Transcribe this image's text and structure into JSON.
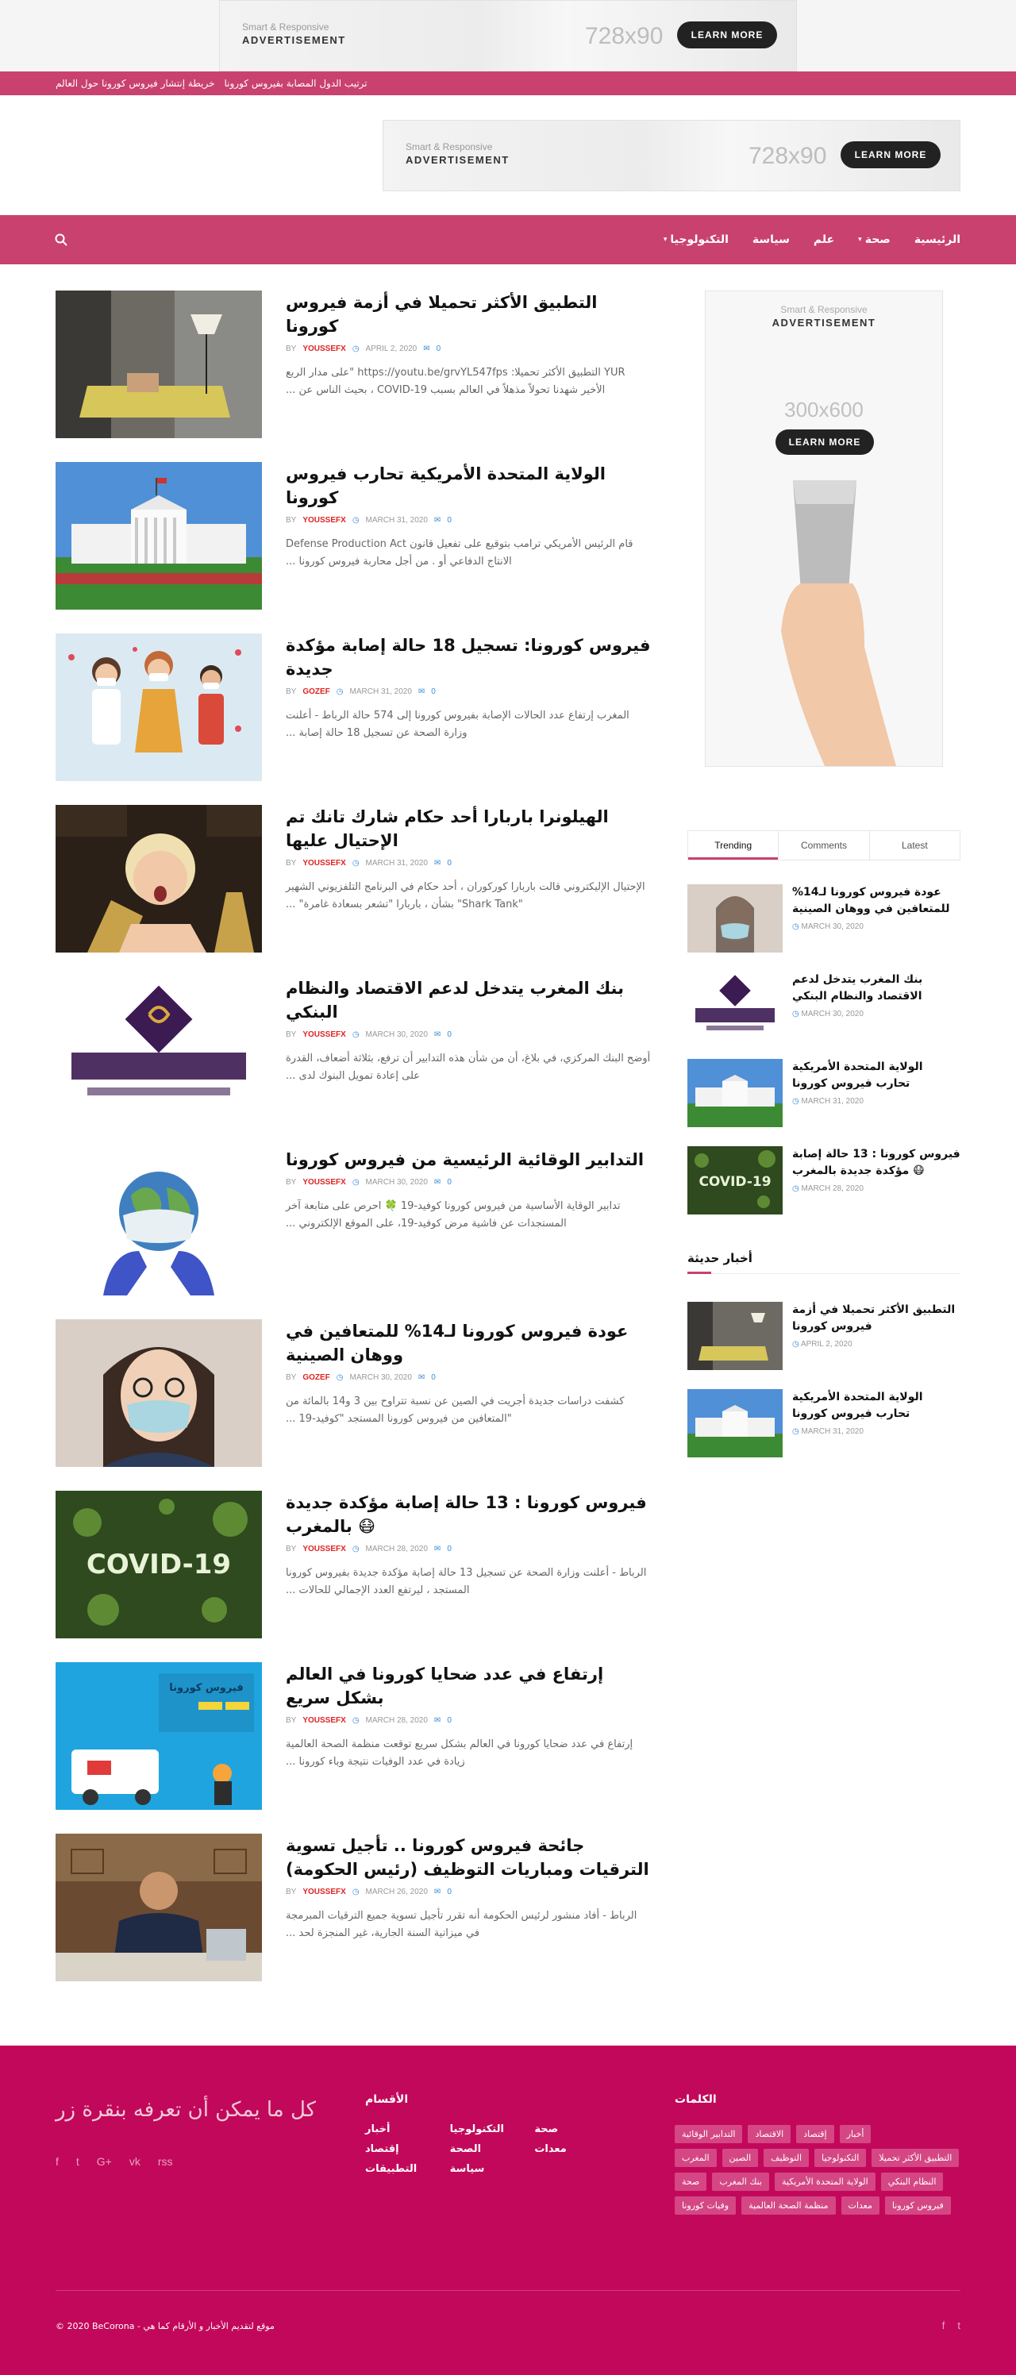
{
  "ads": {
    "top_small": "Smart & Responsive",
    "top_big": "ADVERTISEMENT",
    "top_size": "728x90",
    "top_button": "LEARN MORE",
    "header_small": "Smart & Responsive",
    "header_big": "ADVERTISEMENT",
    "header_size": "728x90",
    "header_button": "LEARN MORE",
    "side_small": "Smart & Responsive",
    "side_big": "ADVERTISEMENT",
    "side_size": "300x600",
    "side_button": "LEARN MORE"
  },
  "trending_links": [
    "ترتيب الدول المصابة بفيروس كورونا",
    "خريطة إنتشار فيروس كورونا حول العالم"
  ],
  "nav": {
    "items": [
      "الرئيسية",
      "صحة",
      "علم",
      "سياسة",
      "التكنولوجيا"
    ],
    "search_icon": "search-icon"
  },
  "articles": [
    {
      "title": "التطبيق الأكثر تحميلا في أزمة فيروس كورونا",
      "by": "BY",
      "author": "YOUSSEFX",
      "date": "APRIL 2, 2020",
      "comments": "0",
      "excerpt": "YUR التطبيق الأكثر تحميلا: https://youtu.be/grvYL547fps \"على مدار الربع الأخير شهدنا تحولاً مذهلاً في العالم بسبب COVID-19 ، بحيث الناس عن ..."
    },
    {
      "title": "الولاية المتحدة الأمريكية تحارب فيروس كورونا",
      "by": "BY",
      "author": "YOUSSEFX",
      "date": "MARCH 31, 2020",
      "comments": "0",
      "excerpt": "قام الرئيس الأمريكي ترامب بتوقيع على تفعيل قانون Defense Production Act الانتاج الدفاعي أو . من أجل محاربة فيروس كورونا ..."
    },
    {
      "title": "فيروس كورونا: تسجيل 18 حالة إصابة مؤكدة جديدة",
      "by": "BY",
      "author": "GOZEF",
      "date": "MARCH 31, 2020",
      "comments": "0",
      "excerpt": "المغرب إرتفاع عدد الحالات الإصابة بفيروس كورونا إلى 574 حالة الرباط - أعلنت وزارة الصحة عن تسجيل 18 حالة إصابة ..."
    },
    {
      "title": "الهيلونرا باربارا أحد حكام شارك تانك تم الإحتيال عليها",
      "by": "BY",
      "author": "YOUSSEFX",
      "date": "MARCH 31, 2020",
      "comments": "0",
      "excerpt": "الإحتيال الإليكتروني قالت باربارا كوركوران ، أحد حكام في البرنامج التلفزيوني الشهير \"Shark Tank\" بشأن ، باربارا \"تشعر بسعادة غامرة\" ..."
    },
    {
      "title": "بنك المغرب يتدخل لدعم الاقتصاد والنظام البنكي",
      "by": "BY",
      "author": "YOUSSEFX",
      "date": "MARCH 30, 2020",
      "comments": "0",
      "excerpt": "أوضح البنك المركزي، في بلاغ، أن من شأن هذه التدابير أن ترفع، بثلاثة أضعاف، القدرة على إعادة تمويل البنوك لدى ..."
    },
    {
      "title": "التدابير الوقائية الرئيسية من فيروس كورونا",
      "by": "BY",
      "author": "YOUSSEFX",
      "date": "MARCH 30, 2020",
      "comments": "0",
      "excerpt": "تدابير الوقاية الأساسية من فيروس كورونا كوفيد-19 🍀 احرص على متابعة آخر المستجدات عن فاشية مرض كوفيد-19، على الموقع الإلكتروني ..."
    },
    {
      "title": "عودة فيروس كورونا لـ14% للمتعافين في ووهان الصينية",
      "by": "BY",
      "author": "GOZEF",
      "date": "MARCH 30, 2020",
      "comments": "0",
      "excerpt": "كشفت دراسات جديدة أجريت في الصين عن نسبة تتراوح بين 3 و14 بالمائة من \"المتعافين من فيروس كورونا المستجد \"كوفيد-19 ..."
    },
    {
      "title": "فيروس كورونا : 13 حالة إصابة مؤكدة جديدة 😷 بالمغرب",
      "by": "BY",
      "author": "YOUSSEFX",
      "date": "MARCH 28, 2020",
      "comments": "0",
      "excerpt": "الرباط - أعلنت وزارة الصحة عن تسجيل 13 حالة إصابة مؤكدة جديدة بفيروس كورونا المستجد ، ليرتفع العدد الإجمالي للحالات ..."
    },
    {
      "title": "إرتفاع في عدد ضحايا كورونا في العالم بشكل سريع",
      "by": "BY",
      "author": "YOUSSEFX",
      "date": "MARCH 28, 2020",
      "comments": "0",
      "excerpt": "إرتفاع في عدد ضحايا كورونا في العالم بشكل سريع توقعت منظمة الصحة العالمية زيادة في عدد الوفيات نتيجة وباء كورونا ..."
    },
    {
      "title": "جائحة فيروس كورونا .. تأجيل تسوية الترقيات ومباريات التوظيف (رئيس الحكومة)",
      "by": "BY",
      "author": "YOUSSEFX",
      "date": "MARCH 26, 2020",
      "comments": "0",
      "excerpt": "الرباط - أفاد منشور لرئيس الحكومة أنه تقرر تأجيل تسوية جميع الترقيات المبرمجة في ميزانية السنة الجارية، غير المنجزة لحد ..."
    }
  ],
  "tabs": [
    "Trending",
    "Comments",
    "Latest"
  ],
  "trending": [
    {
      "title": "عودة فيروس كورونا لـ14% للمتعافين في ووهان الصينية",
      "date": "MARCH 30, 2020"
    },
    {
      "title": "بنك المغرب يتدخل لدعم الاقتصاد والنظام البنكي",
      "date": "MARCH 30, 2020"
    },
    {
      "title": "الولاية المتحدة الأمريكية تحارب فيروس كورونا",
      "date": "MARCH 31, 2020"
    },
    {
      "title": "فيروس كورونا : 13 حالة إصابة 😷 مؤكدة جديدة بالمغرب",
      "date": "MARCH 28, 2020"
    }
  ],
  "recent_heading": "أخبار حديثة",
  "recent": [
    {
      "title": "التطبيق الأكثر تحميلا في أزمة فيروس كورونا",
      "date": "APRIL 2, 2020"
    },
    {
      "title": "الولاية المتحدة الأمريكية تحارب فيروس كورونا",
      "date": "MARCH 31, 2020"
    }
  ],
  "footer": {
    "tagline": "كل ما يمكن أن تعرفه بنقرة زر",
    "sections_title": "الأقسام",
    "sections": [
      "صحة",
      "التكنولوجيا",
      "أخبار",
      "معدات",
      "الصحة",
      "إقتصاد",
      "",
      "سياسة",
      "التطبيقات"
    ],
    "tags_title": "الكلمات",
    "tags": [
      "أخبار",
      "إقتصاد",
      "الاقتصاد",
      "التدابير الوقائية",
      "التطبيق الأكثر تحميلا",
      "التكنولوجيا",
      "التوظيف",
      "الصين",
      "المغرب",
      "النظام البنكي",
      "الولاية المتحدة الأمريكية",
      "بنك المغرب",
      "صحة",
      "فيروس كورونا",
      "معدات",
      "منظمة الصحة العالمية",
      "وفيات كورونا"
    ],
    "copyright": "© 2020 BeCorona - موقع لتقديم الأخبار و الأرقام كما هي",
    "social": [
      "f",
      "t",
      "G+",
      "vk",
      "rss"
    ],
    "social_right": [
      "f",
      "t"
    ]
  },
  "colors": {
    "brand": "#c9416f",
    "footer": "#c2085a",
    "accent": "#3b8ad8",
    "author": "#e02222"
  }
}
